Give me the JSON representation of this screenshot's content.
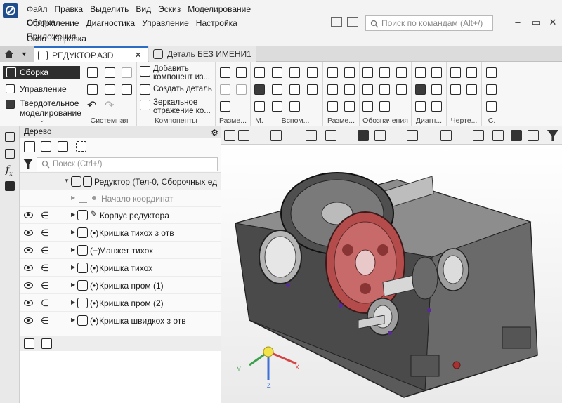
{
  "menu": {
    "row1": [
      "Файл",
      "Правка",
      "Выделить",
      "Вид",
      "Эскиз",
      "Моделирование",
      "Сборка"
    ],
    "row2": [
      "Оформление",
      "Диагностика",
      "Управление",
      "Настройка",
      "Приложения"
    ],
    "row3": [
      "Окно",
      "Справка"
    ]
  },
  "command_search": {
    "placeholder": "Поиск по командам (Alt+/)"
  },
  "tabs": [
    {
      "label": "РЕДУКТОР.А3D",
      "active": true
    },
    {
      "label": "Деталь БЕЗ ИМЕНИ1",
      "active": false
    }
  ],
  "ribbon": {
    "left_items": [
      "Сборка",
      "Управление",
      "Твердотельное моделирование"
    ],
    "commands": [
      "Добавить компонент из...",
      "Создать деталь",
      "Зеркальное отражение ко..."
    ],
    "groups": [
      "Системная",
      "Компоненты",
      "Разме...",
      "М.",
      "Вспом...",
      "Разме...",
      "Обозначения",
      "Диагн...",
      "Черте...",
      "С."
    ]
  },
  "tree": {
    "title": "Дерево",
    "search_placeholder": "Поиск (Ctrl+/)",
    "root": "Редуктор (Тел-0, Сборочных ед",
    "origin": "Начало координат",
    "items": [
      "Корпус редуктора",
      "Кришка тихох з отв",
      "Манжет тихох",
      "Кришка тихох",
      "Кришка пром (1)",
      "Кришка пром (2)",
      "Кришка швидкох з отв"
    ],
    "item_prefixes": [
      "",
      "(•)",
      "(−)",
      "(•)",
      "(•)",
      "(•)",
      "(•)"
    ]
  },
  "viewport": {
    "axes": {
      "x": "X",
      "y": "Y",
      "z": "Z"
    },
    "colors": {
      "body": "#4a4a4a",
      "gear_large": "#6d6d6d",
      "gear_red": "#b44c4c",
      "axis_x": "#d64545",
      "axis_y": "#3aa04a",
      "axis_z": "#3d6fd6"
    }
  }
}
